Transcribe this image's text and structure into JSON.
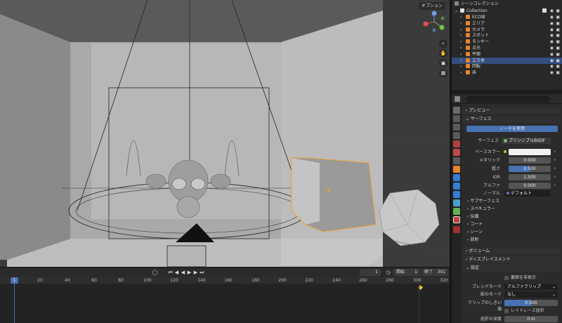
{
  "viewport": {
    "options_label": "オプション"
  },
  "timeline": {
    "ticks": [
      "1",
      "20",
      "40",
      "60",
      "80",
      "100",
      "120",
      "140",
      "160",
      "180",
      "200",
      "220",
      "240",
      "260",
      "280",
      "300",
      "320"
    ],
    "current_frame": "1",
    "start_label": "開始",
    "start_value": "1",
    "end_label": "終了",
    "end_value": "301",
    "frame_field": "1"
  },
  "outliner": {
    "title": "シーンコレクション",
    "collection": "Collection",
    "items": [
      {
        "label": "ECO球",
        "color": "#e8852b"
      },
      {
        "label": "エリア",
        "color": "#e8852b"
      },
      {
        "label": "カメラ",
        "color": "#e8852b"
      },
      {
        "label": "スポット",
        "color": "#e8852b"
      },
      {
        "label": "モンキー",
        "color": "#e8852b"
      },
      {
        "label": "点光",
        "color": "#e8852b"
      },
      {
        "label": "平面",
        "color": "#e8852b"
      },
      {
        "label": "立方体",
        "color": "#e8852b"
      },
      {
        "label": "回転",
        "color": "#e8852b"
      },
      {
        "label": "床",
        "color": "#e8852b"
      }
    ]
  },
  "properties": {
    "preview": "プレビュー",
    "surface": "サーフェス",
    "use_nodes": "ノードを使用",
    "surface_label": "サーフェス",
    "surface_value": "プリンシプルBSDF",
    "base_color_label": "ベースカラー",
    "metallic_label": "メタリック",
    "metallic_value": "0.000",
    "roughness_label": "粗さ",
    "roughness_value": "0.500",
    "ior_label": "IOR",
    "ior_value": "1.500",
    "alpha_label": "アルファ",
    "alpha_value": "0.000",
    "normal_label": "ノーマル",
    "normal_value": "デフォルト",
    "subsurface": "サブサーフェス",
    "specular": "スペキュラー",
    "transmission": "伝播",
    "coat": "コート",
    "sheen": "シーン",
    "emission": "放射",
    "volume": "ボリューム",
    "displacement": "ディスプレイスメント",
    "settings": "設定",
    "backface_label": "裏面を非表示",
    "blend_mode_label": "ブレンドモード",
    "blend_mode_value": "アルファクリップ",
    "shadow_mode_label": "影のモード",
    "shadow_mode_value": "なし",
    "clip_threshold_label": "クリップのしきい値",
    "clip_threshold_value": "0.500",
    "raytrace_label": "レイトレース屈折",
    "refraction_depth_label": "屈折の深度",
    "refraction_depth_value": "0 m"
  }
}
